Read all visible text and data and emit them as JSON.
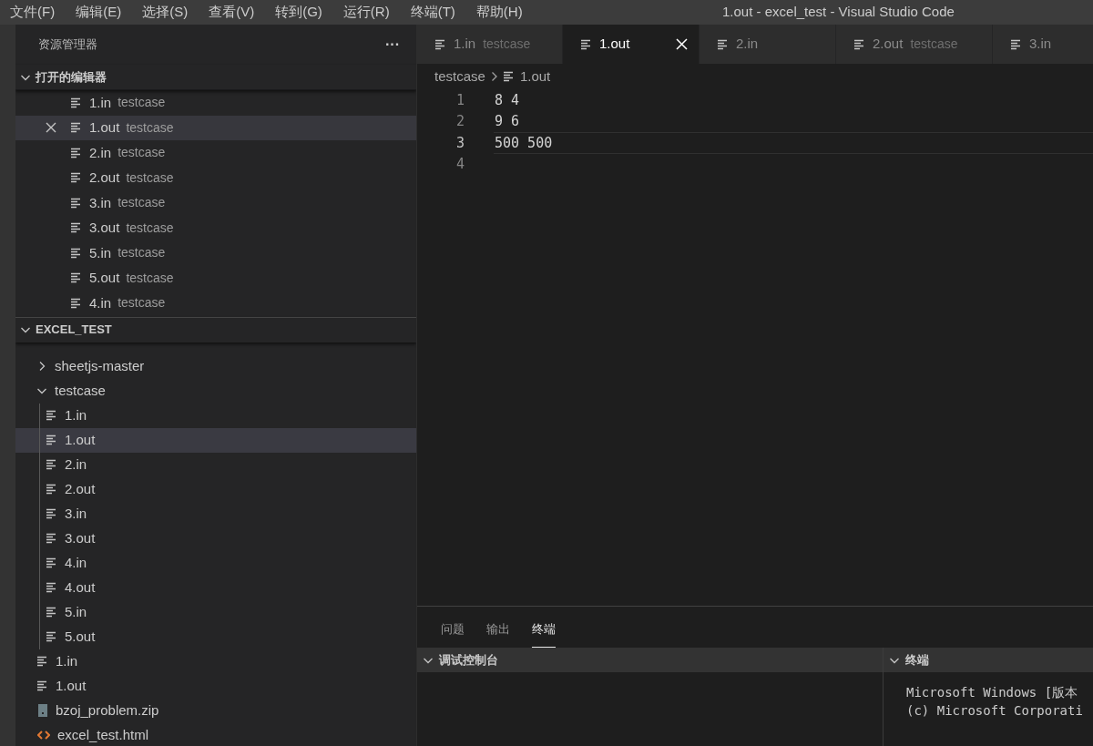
{
  "menu": [
    "文件(F)",
    "编辑(E)",
    "选择(S)",
    "查看(V)",
    "转到(G)",
    "运行(R)",
    "终端(T)",
    "帮助(H)"
  ],
  "title": "1.out - excel_test - Visual Studio Code",
  "sidebar": {
    "title": "资源管理器",
    "more": "···",
    "open_editors": {
      "title": "打开的编辑器",
      "expanded": true,
      "items": [
        {
          "name": "1.in",
          "folder": "testcase",
          "selected": false
        },
        {
          "name": "1.out",
          "folder": "testcase",
          "selected": true
        },
        {
          "name": "2.in",
          "folder": "testcase",
          "selected": false
        },
        {
          "name": "2.out",
          "folder": "testcase",
          "selected": false
        },
        {
          "name": "3.in",
          "folder": "testcase",
          "selected": false
        },
        {
          "name": "3.out",
          "folder": "testcase",
          "selected": false
        },
        {
          "name": "5.in",
          "folder": "testcase",
          "selected": false
        },
        {
          "name": "5.out",
          "folder": "testcase",
          "selected": false
        },
        {
          "name": "4.in",
          "folder": "testcase",
          "selected": false
        }
      ]
    },
    "folder": {
      "title": "EXCEL_TEST",
      "expanded": true,
      "tree": [
        {
          "name": "sheetjs-master",
          "kind": "folder",
          "expanded": false,
          "selected": false
        },
        {
          "name": "testcase",
          "kind": "folder",
          "expanded": true,
          "selected": false,
          "children": [
            {
              "name": "1.in",
              "kind": "text",
              "selected": false
            },
            {
              "name": "1.out",
              "kind": "text",
              "selected": true
            },
            {
              "name": "2.in",
              "kind": "text",
              "selected": false
            },
            {
              "name": "2.out",
              "kind": "text",
              "selected": false
            },
            {
              "name": "3.in",
              "kind": "text",
              "selected": false
            },
            {
              "name": "3.out",
              "kind": "text",
              "selected": false
            },
            {
              "name": "4.in",
              "kind": "text",
              "selected": false
            },
            {
              "name": "4.out",
              "kind": "text",
              "selected": false
            },
            {
              "name": "5.in",
              "kind": "text",
              "selected": false
            },
            {
              "name": "5.out",
              "kind": "text",
              "selected": false
            }
          ]
        },
        {
          "name": "1.in",
          "kind": "text",
          "selected": false
        },
        {
          "name": "1.out",
          "kind": "text",
          "selected": false
        },
        {
          "name": "bzoj_problem.zip",
          "kind": "zip",
          "selected": false
        },
        {
          "name": "excel_test.html",
          "kind": "html",
          "selected": false
        }
      ]
    }
  },
  "editor": {
    "tabs": [
      {
        "name": "1.in",
        "description": "testcase",
        "selected": false
      },
      {
        "name": "1.out",
        "selected": true
      },
      {
        "name": "2.in",
        "selected": false
      },
      {
        "name": "2.out",
        "description": "testcase",
        "selected": false
      },
      {
        "name": "3.in",
        "selected": false
      }
    ],
    "breadcrumb": [
      "testcase",
      "1.out"
    ],
    "lines": [
      {
        "number": "1",
        "text": "8 4",
        "current": false
      },
      {
        "number": "2",
        "text": "9 6",
        "current": false
      },
      {
        "number": "3",
        "text": "500 500",
        "current": true
      },
      {
        "number": "4",
        "current": false
      }
    ]
  },
  "panel": {
    "tabs": [
      {
        "label": "问题",
        "selected": false
      },
      {
        "label": "输出",
        "selected": false
      },
      {
        "label": "终端",
        "selected": true
      }
    ],
    "sections": [
      {
        "title": "调试控制台",
        "expanded": true
      },
      {
        "title": "终端",
        "expanded": true,
        "lines": [
          "Microsoft Windows [版本",
          "(c) Microsoft Corporati"
        ]
      }
    ]
  }
}
